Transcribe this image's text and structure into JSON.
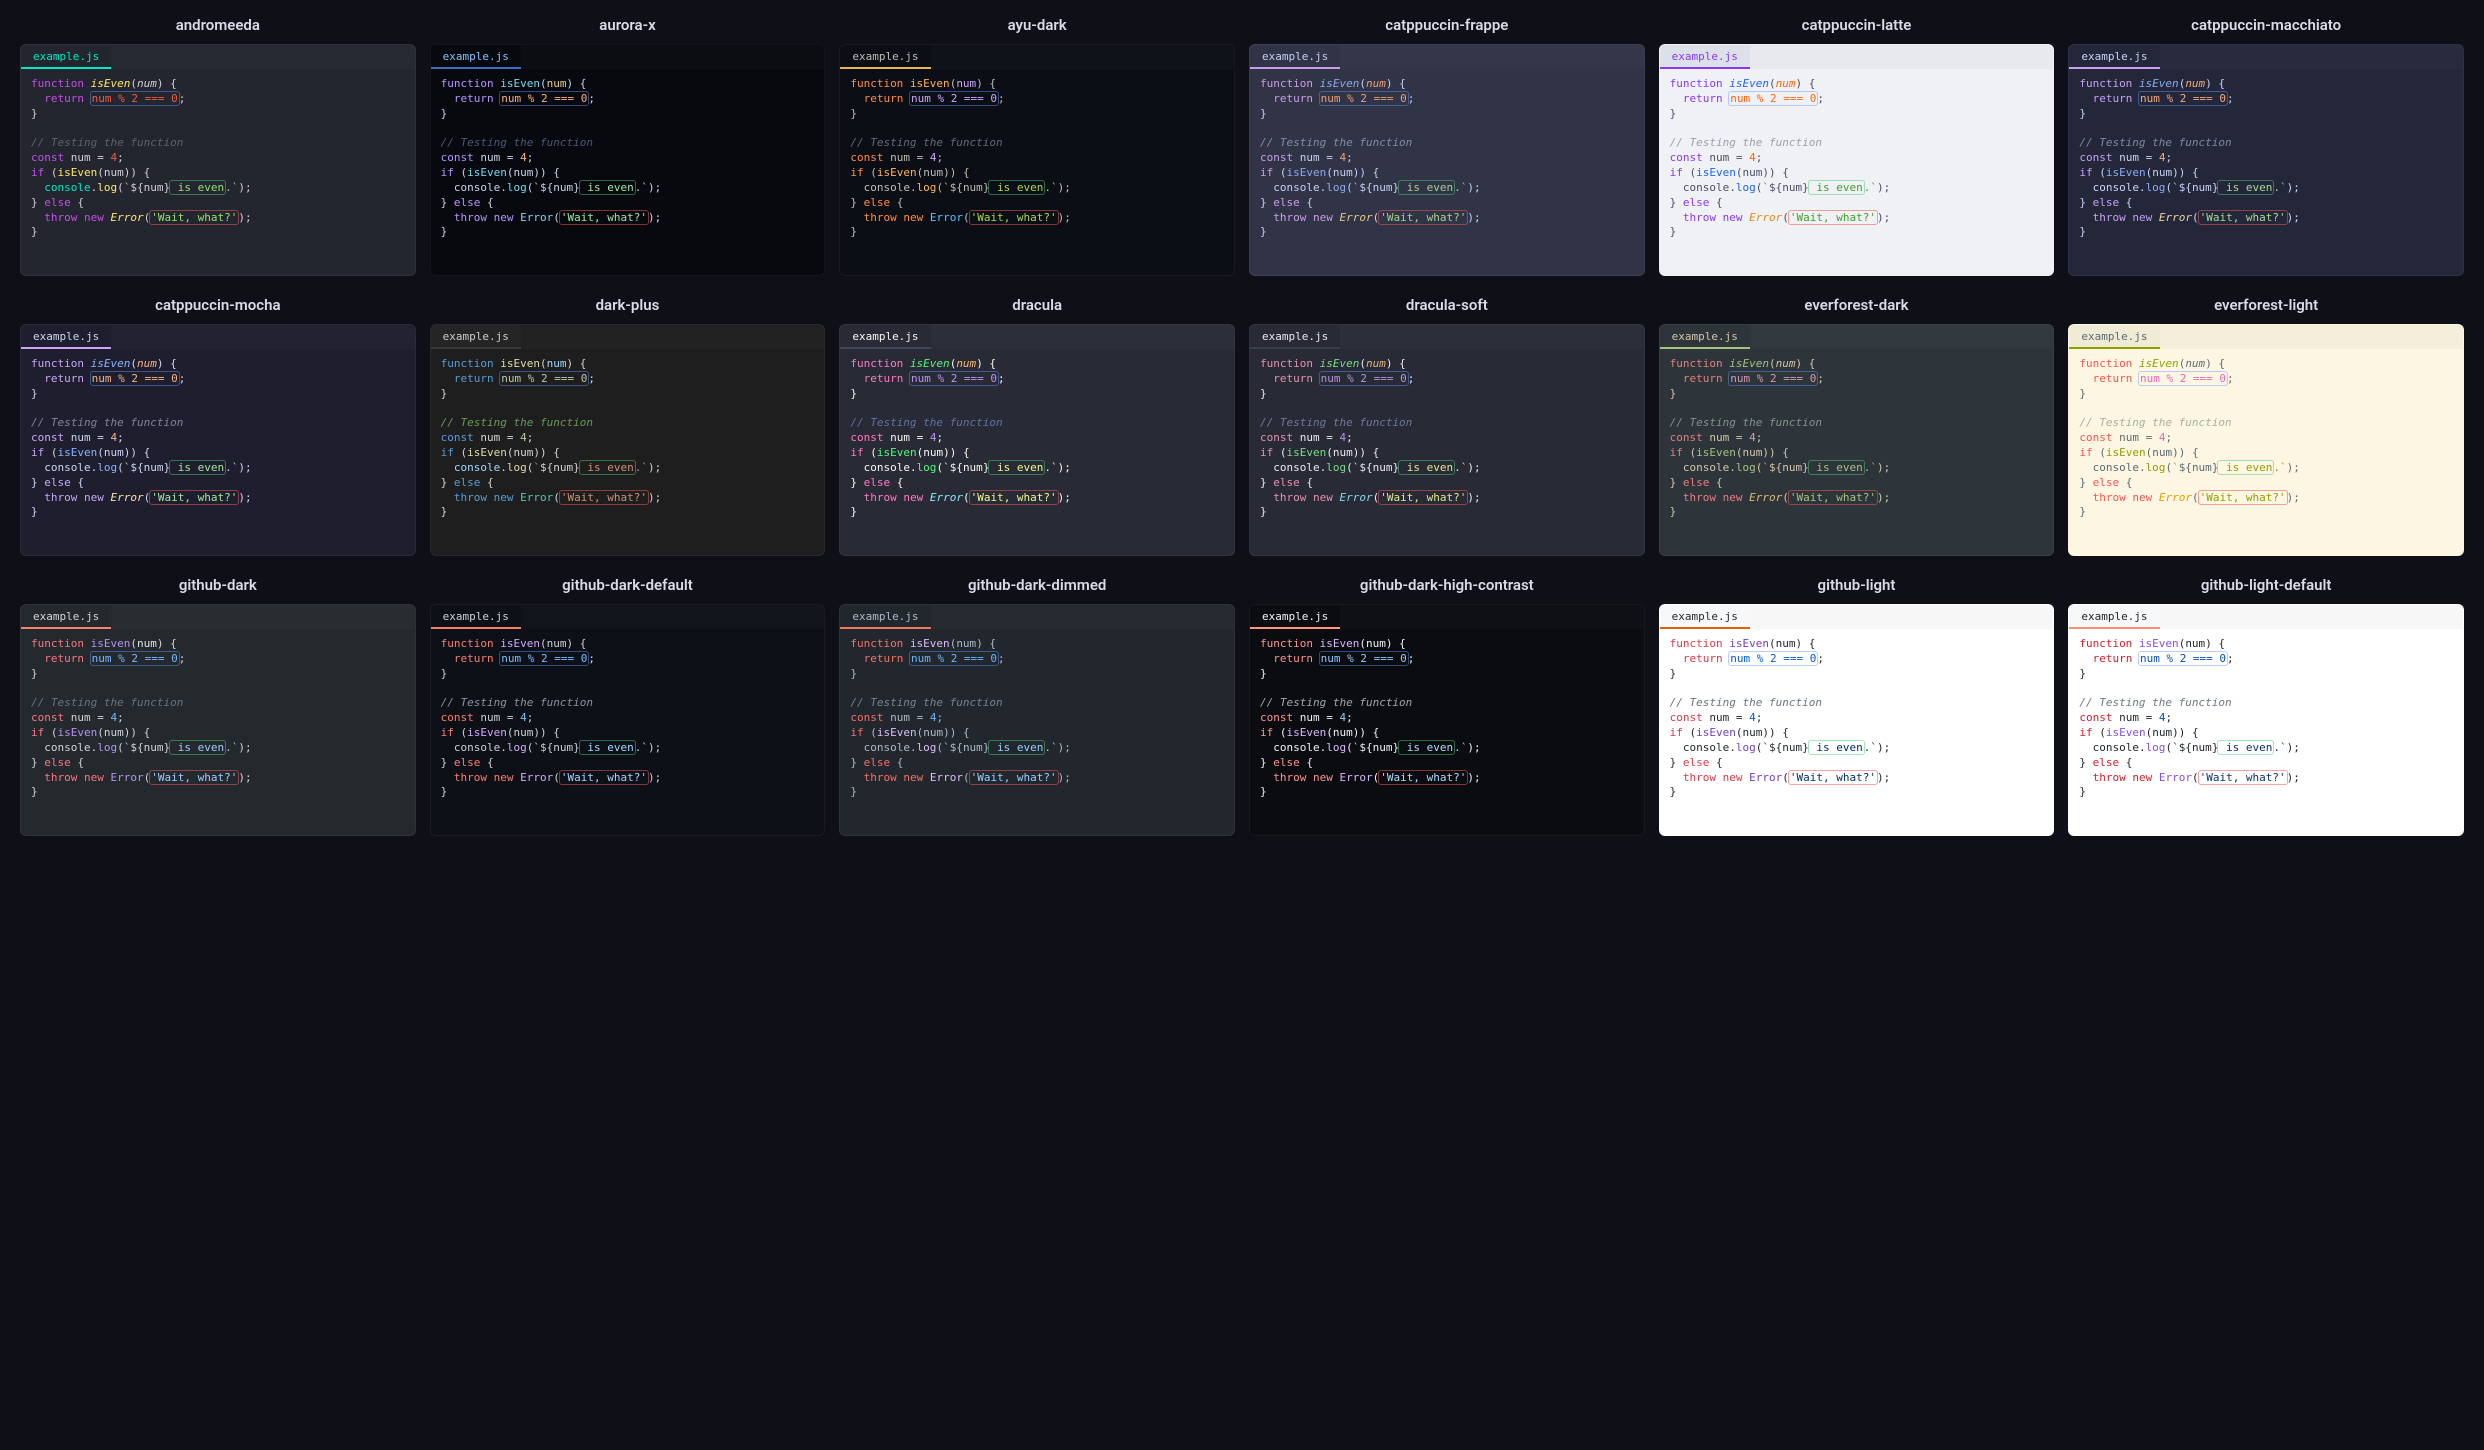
{
  "filename": "example.js",
  "code": {
    "kw_function": "function",
    "kw_return": "return",
    "kw_const": "const",
    "kw_if": "if",
    "kw_else": "else",
    "kw_throw": "throw",
    "kw_new": "new",
    "fn_isEven": "isEven",
    "param_num": "num",
    "expr_mod": "num % 2 === 0",
    "comment": "// Testing the function",
    "num_4": "4",
    "obj_console": "console",
    "fn_log": "log",
    "var_num": "num",
    "str_is_even": " is even",
    "str_dot": ".",
    "cls_Error": "Error",
    "str_wait": "'Wait, what?'"
  },
  "themes": [
    {
      "name": "andromeeda",
      "bg": "#23262e",
      "tabBg": "#23262e",
      "tabFg": "#00e8c6",
      "tabBorder": "#00e8c6",
      "fg": "#d5ced9",
      "kw": "#c74ded",
      "fn": "#ffe66d",
      "param": "#d5ced9",
      "num": "#ee5d43",
      "str": "#96e072",
      "comment": "#5f6167",
      "err": "#ffe66d",
      "console": "#00e8c6",
      "italic_param": true
    },
    {
      "name": "aurora-x",
      "bg": "#07090f",
      "tabBg": "#07090f",
      "tabFg": "#85c1ff",
      "tabBorder": "#3b6fc4",
      "fg": "#c9d4e8",
      "kw": "#b894ff",
      "fn": "#7ad7f0",
      "param": "#e6d08e",
      "num": "#ffb080",
      "str": "#a0e6a0",
      "comment": "#4a5878",
      "err": "#7ad7f0",
      "console": "#c9d4e8",
      "italic_param": false
    },
    {
      "name": "ayu-dark",
      "bg": "#0b0e14",
      "tabBg": "#0b0e14",
      "tabFg": "#bfbdb6",
      "tabBorder": "#e6b450",
      "fg": "#bfbdb6",
      "kw": "#ff8f40",
      "fn": "#ffb454",
      "param": "#d2a6ff",
      "num": "#d2a6ff",
      "str": "#aad94c",
      "comment": "#636a78",
      "err": "#59c2ff",
      "console": "#bfbdb6",
      "italic_param": false
    },
    {
      "name": "catppuccin-frappe",
      "bg": "#303446",
      "tabBg": "#303446",
      "tabFg": "#c6d0f5",
      "tabBorder": "#ca9ee6",
      "fg": "#c6d0f5",
      "kw": "#ca9ee6",
      "fn": "#8caaee",
      "param": "#ef9f76",
      "num": "#ef9f76",
      "str": "#a6d189",
      "comment": "#838ba7",
      "err": "#e5c890",
      "console": "#c6d0f5",
      "italic_param": true
    },
    {
      "name": "catppuccin-latte",
      "bg": "#eff1f5",
      "tabBg": "#dce0e8",
      "tabFg": "#8839ef",
      "tabBorder": "#8839ef",
      "light": true,
      "fg": "#4c4f69",
      "kw": "#8839ef",
      "fn": "#1e66f5",
      "param": "#fe640b",
      "num": "#fe640b",
      "str": "#40a02b",
      "comment": "#9ca0b0",
      "err": "#df8e1d",
      "console": "#4c4f69",
      "italic_param": true
    },
    {
      "name": "catppuccin-macchiato",
      "bg": "#24273a",
      "tabBg": "#24273a",
      "tabFg": "#cad3f5",
      "tabBorder": "#c6a0f6",
      "fg": "#cad3f5",
      "kw": "#c6a0f6",
      "fn": "#8aadf4",
      "param": "#f5a97f",
      "num": "#f5a97f",
      "str": "#a6da95",
      "comment": "#8087a2",
      "err": "#eed49f",
      "console": "#cad3f5",
      "italic_param": true
    },
    {
      "name": "catppuccin-mocha",
      "bg": "#1e1e2e",
      "tabBg": "#1e1e2e",
      "tabFg": "#cdd6f4",
      "tabBorder": "#cba6f7",
      "fg": "#cdd6f4",
      "kw": "#cba6f7",
      "fn": "#89b4fa",
      "param": "#fab387",
      "num": "#fab387",
      "str": "#a6e3a1",
      "comment": "#7f849c",
      "err": "#f9e2af",
      "console": "#cdd6f4",
      "italic_param": true
    },
    {
      "name": "dark-plus",
      "bg": "#1e1e1e",
      "tabBg": "#252526",
      "tabFg": "#cccccc",
      "tabBorder": "#3a3a3a",
      "fg": "#d4d4d4",
      "kw": "#569cd6",
      "fn": "#dcdcaa",
      "param": "#9cdcfe",
      "num": "#b5cea8",
      "str": "#ce9178",
      "comment": "#6a9955",
      "err": "#4ec9b0",
      "console": "#9cdcfe",
      "italic_param": false
    },
    {
      "name": "dracula",
      "bg": "#282a36",
      "tabBg": "#282a36",
      "tabFg": "#f8f8f2",
      "tabBorder": "#44475a",
      "fg": "#f8f8f2",
      "kw": "#ff79c6",
      "fn": "#50fa7b",
      "param": "#ffb86c",
      "num": "#bd93f9",
      "str": "#f1fa8c",
      "comment": "#6272a4",
      "err": "#8be9fd",
      "console": "#f8f8f2",
      "italic_param": true
    },
    {
      "name": "dracula-soft",
      "bg": "#282a36",
      "tabBg": "#282a36",
      "tabFg": "#e9e9f4",
      "tabBorder": "#3b3d4d",
      "fg": "#e9e9f4",
      "kw": "#e690b4",
      "fn": "#77dd84",
      "param": "#e4b47a",
      "num": "#b394e0",
      "str": "#e1e88e",
      "comment": "#6d789a",
      "err": "#89d7ea",
      "console": "#e9e9f4",
      "italic_param": true
    },
    {
      "name": "everforest-dark",
      "bg": "#2d353b",
      "tabBg": "#2d353b",
      "tabFg": "#d3c6aa",
      "tabBorder": "#a7c080",
      "fg": "#d3c6aa",
      "kw": "#e67e80",
      "fn": "#a7c080",
      "param": "#d3c6aa",
      "num": "#d699b6",
      "str": "#a7c080",
      "comment": "#859289",
      "err": "#dbbc7f",
      "console": "#d3c6aa",
      "italic_param": true
    },
    {
      "name": "everforest-light",
      "bg": "#fdf6e3",
      "tabBg": "#efebd4",
      "tabFg": "#5c6a72",
      "tabBorder": "#8da101",
      "light": true,
      "fg": "#5c6a72",
      "kw": "#f85552",
      "fn": "#8da101",
      "param": "#5c6a72",
      "num": "#df69ba",
      "str": "#8da101",
      "comment": "#a6b0a0",
      "err": "#dfa000",
      "console": "#5c6a72",
      "italic_param": true
    },
    {
      "name": "github-dark",
      "bg": "#24292e",
      "tabBg": "#24292e",
      "tabFg": "#d1d5da",
      "tabBorder": "#f9826c",
      "fg": "#d1d5da",
      "kw": "#f97583",
      "fn": "#b392f0",
      "param": "#e1e4e8",
      "num": "#79b8ff",
      "str": "#9ecbff",
      "comment": "#6a737d",
      "err": "#b392f0",
      "console": "#d1d5da",
      "italic_param": false
    },
    {
      "name": "github-dark-default",
      "bg": "#0d1117",
      "tabBg": "#0d1117",
      "tabFg": "#c9d1d9",
      "tabBorder": "#f78166",
      "fg": "#c9d1d9",
      "kw": "#ff7b72",
      "fn": "#d2a8ff",
      "param": "#c9d1d9",
      "num": "#79c0ff",
      "str": "#a5d6ff",
      "comment": "#8b949e",
      "err": "#d2a8ff",
      "console": "#c9d1d9",
      "italic_param": false
    },
    {
      "name": "github-dark-dimmed",
      "bg": "#22272e",
      "tabBg": "#22272e",
      "tabFg": "#adbac7",
      "tabBorder": "#ec775c",
      "fg": "#adbac7",
      "kw": "#f47067",
      "fn": "#dcbdfb",
      "param": "#adbac7",
      "num": "#6cb6ff",
      "str": "#96d0ff",
      "comment": "#768390",
      "err": "#dcbdfb",
      "console": "#adbac7",
      "italic_param": false
    },
    {
      "name": "github-dark-high-contrast",
      "bg": "#0a0c10",
      "tabBg": "#0a0c10",
      "tabFg": "#f0f3f6",
      "tabBorder": "#ff967d",
      "fg": "#f0f3f6",
      "kw": "#ff9492",
      "fn": "#dbb7ff",
      "param": "#f0f3f6",
      "num": "#91cbff",
      "str": "#addcff",
      "comment": "#9ea7b3",
      "err": "#dbb7ff",
      "console": "#f0f3f6",
      "italic_param": false
    },
    {
      "name": "github-light",
      "bg": "#ffffff",
      "tabBg": "#f6f8fa",
      "tabFg": "#24292e",
      "tabBorder": "#e36209",
      "light": true,
      "fg": "#24292e",
      "kw": "#d73a49",
      "fn": "#6f42c1",
      "param": "#24292e",
      "num": "#005cc5",
      "str": "#032f62",
      "comment": "#6a737d",
      "err": "#6f42c1",
      "console": "#24292e",
      "italic_param": false
    },
    {
      "name": "github-light-default",
      "bg": "#ffffff",
      "tabBg": "#f6f8fa",
      "tabFg": "#1f2328",
      "tabBorder": "#fd8c73",
      "light": true,
      "fg": "#1f2328",
      "kw": "#cf222e",
      "fn": "#8250df",
      "param": "#1f2328",
      "num": "#0550ae",
      "str": "#0a3069",
      "comment": "#6e7781",
      "err": "#8250df",
      "console": "#1f2328",
      "italic_param": false
    }
  ]
}
